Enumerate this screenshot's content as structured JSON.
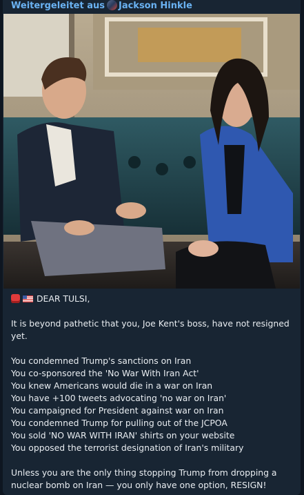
{
  "forward": {
    "prefix": "Weitergeleitet aus",
    "source": "Jackson Hinkle"
  },
  "photo": {
    "icon": "photo-two-people-interview"
  },
  "message": {
    "greeting": "DEAR TULSI,",
    "intro_lines": [
      "It is beyond pathetic that you, Joe Kent's boss, have not resigned",
      "yet."
    ],
    "points": [
      "You condemned Trump's sanctions on Iran",
      "You co-sponsored the 'No War With Iran Act'",
      "You knew Americans would die in a war on Iran",
      "You have +100 tweets advocating 'no war on Iran'",
      "You campaigned for President against war on Iran",
      "You condemned Trump for pulling out of the JCPOA",
      "You sold 'NO WAR WITH IRAN' shirts on your website",
      "You opposed the terrorist designation of Iran's military"
    ],
    "closing_lines": [
      "Unless you are the only thing stopping Trump from dropping a",
      "nuclear bomb on Iran — you only have one option, RESIGN!"
    ]
  },
  "colors": {
    "background": "#0e1621",
    "bubble": "#182533",
    "link": "#6ab2f2",
    "text": "#e9edf1"
  }
}
